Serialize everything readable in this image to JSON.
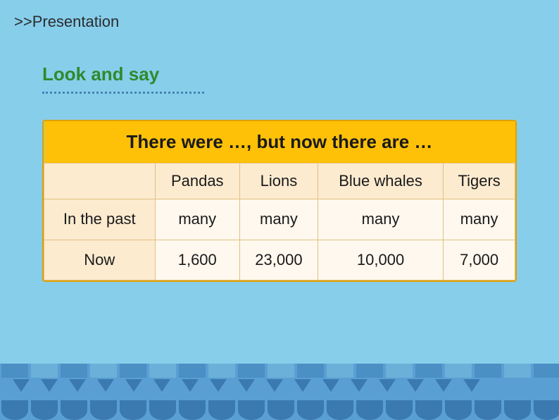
{
  "header": {
    "breadcrumb": ">>Presentation"
  },
  "subtitle": {
    "label": "Look and say"
  },
  "table": {
    "title": "There were …, but now there are …",
    "columns": [
      "",
      "Pandas",
      "Lions",
      "Blue whales",
      "Tigers"
    ],
    "rows": [
      {
        "label": "In the past",
        "values": [
          "many",
          "many",
          "many",
          "many"
        ]
      },
      {
        "label": "Now",
        "values": [
          "1,600",
          "23,000",
          "10,000",
          "7,000"
        ]
      }
    ]
  }
}
